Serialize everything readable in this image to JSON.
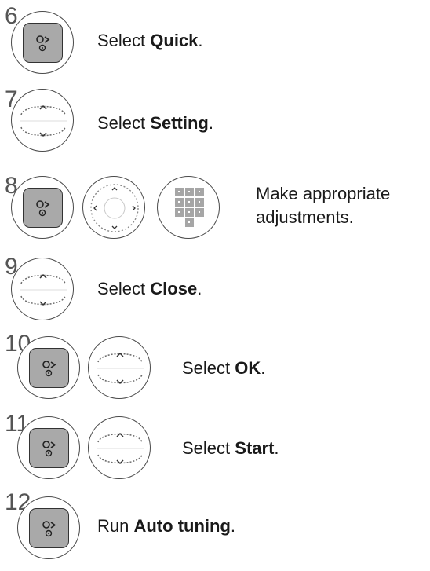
{
  "steps": [
    {
      "number": "6",
      "prefix": "Select ",
      "bold": "Quick",
      "suffix": "."
    },
    {
      "number": "7",
      "prefix": "Select ",
      "bold": "Setting",
      "suffix": "."
    },
    {
      "number": "8",
      "line1": "Make appropriate",
      "line2": "adjustments."
    },
    {
      "number": "9",
      "prefix": "Select ",
      "bold": "Close",
      "suffix": "."
    },
    {
      "number": "10",
      "prefix": "Select ",
      "bold": "OK",
      "suffix": "."
    },
    {
      "number": "11",
      "prefix": "Select ",
      "bold": "Start",
      "suffix": "."
    },
    {
      "number": "12",
      "prefix": "Run ",
      "bold": "Auto tuning",
      "suffix": "."
    }
  ],
  "icons": {
    "ok": "ok-button-icon",
    "updown": "up-down-button-icon",
    "navpad": "navigation-pad-icon",
    "numpad": "number-keypad-icon"
  }
}
